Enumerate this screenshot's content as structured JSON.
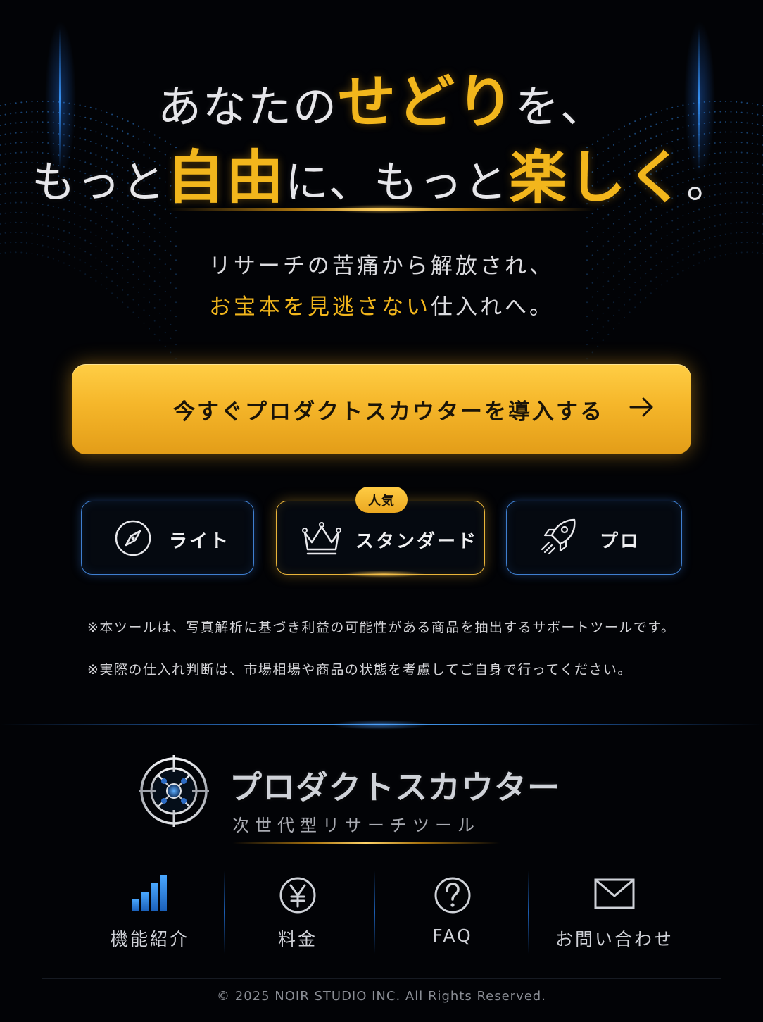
{
  "hero": {
    "line1_a": "あなたの",
    "line1_gold": "せどり",
    "line1_b": "を、",
    "line2_a": "もっと",
    "line2_gold1": "自由",
    "line2_b": "に、もっと",
    "line2_gold2": "楽しく",
    "line2_c": "。"
  },
  "subtitle": {
    "line1": "リサーチの苦痛から解放され、",
    "line2_highlight": "お宝本を見逃さない",
    "line2_rest": "仕入れへ。"
  },
  "cta": {
    "label": "今すぐプロダクトスカウターを導入する"
  },
  "plans": [
    {
      "label": "ライト",
      "icon": "compass-icon"
    },
    {
      "label": "スタンダード",
      "icon": "crown-icon",
      "badge": "人気"
    },
    {
      "label": "プロ",
      "icon": "rocket-icon"
    }
  ],
  "notes": [
    "※本ツールは、写真解析に基づき利益の可能性がある商品を抽出するサポートツールです。",
    "※実際の仕入れ判断は、市場相場や商品の状態を考慮してご自身で行ってください。"
  ],
  "brand": {
    "name": "プロダクトスカウター",
    "tagline": "次世代型リサーチツール"
  },
  "footer_nav": [
    {
      "label": "機能紹介",
      "icon": "bar-chart-icon"
    },
    {
      "label": "料金",
      "icon": "yen-icon"
    },
    {
      "label": "FAQ",
      "icon": "question-icon"
    },
    {
      "label": "お問い合わせ",
      "icon": "mail-icon"
    }
  ],
  "copyright": "© 2025 NOIR STUDIO INC. All Rights Reserved.",
  "colors": {
    "gold": "#f2b61c",
    "blue_glow": "#3f7fd0",
    "background": "#020306"
  }
}
